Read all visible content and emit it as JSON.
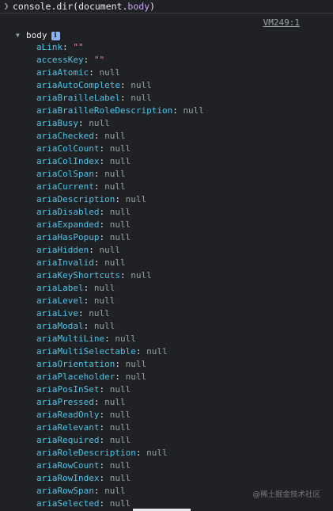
{
  "console": {
    "prompt_icon": "chevron-right-icon",
    "command": {
      "prefix": "console.",
      "method": "dir",
      "open": "(document.",
      "arg_prop": "body",
      "close": ")"
    },
    "source_link": "VM249:1",
    "root": {
      "label": "body",
      "badge": "i",
      "expanded": true
    },
    "properties": [
      {
        "key": "aLink",
        "value": "\"\"",
        "kind": "string"
      },
      {
        "key": "accessKey",
        "value": "\"\"",
        "kind": "string"
      },
      {
        "key": "ariaAtomic",
        "value": "null",
        "kind": "null"
      },
      {
        "key": "ariaAutoComplete",
        "value": "null",
        "kind": "null"
      },
      {
        "key": "ariaBrailleLabel",
        "value": "null",
        "kind": "null"
      },
      {
        "key": "ariaBrailleRoleDescription",
        "value": "null",
        "kind": "null"
      },
      {
        "key": "ariaBusy",
        "value": "null",
        "kind": "null"
      },
      {
        "key": "ariaChecked",
        "value": "null",
        "kind": "null"
      },
      {
        "key": "ariaColCount",
        "value": "null",
        "kind": "null"
      },
      {
        "key": "ariaColIndex",
        "value": "null",
        "kind": "null"
      },
      {
        "key": "ariaColSpan",
        "value": "null",
        "kind": "null"
      },
      {
        "key": "ariaCurrent",
        "value": "null",
        "kind": "null"
      },
      {
        "key": "ariaDescription",
        "value": "null",
        "kind": "null"
      },
      {
        "key": "ariaDisabled",
        "value": "null",
        "kind": "null"
      },
      {
        "key": "ariaExpanded",
        "value": "null",
        "kind": "null"
      },
      {
        "key": "ariaHasPopup",
        "value": "null",
        "kind": "null"
      },
      {
        "key": "ariaHidden",
        "value": "null",
        "kind": "null"
      },
      {
        "key": "ariaInvalid",
        "value": "null",
        "kind": "null"
      },
      {
        "key": "ariaKeyShortcuts",
        "value": "null",
        "kind": "null"
      },
      {
        "key": "ariaLabel",
        "value": "null",
        "kind": "null"
      },
      {
        "key": "ariaLevel",
        "value": "null",
        "kind": "null"
      },
      {
        "key": "ariaLive",
        "value": "null",
        "kind": "null"
      },
      {
        "key": "ariaModal",
        "value": "null",
        "kind": "null"
      },
      {
        "key": "ariaMultiLine",
        "value": "null",
        "kind": "null"
      },
      {
        "key": "ariaMultiSelectable",
        "value": "null",
        "kind": "null"
      },
      {
        "key": "ariaOrientation",
        "value": "null",
        "kind": "null"
      },
      {
        "key": "ariaPlaceholder",
        "value": "null",
        "kind": "null"
      },
      {
        "key": "ariaPosInSet",
        "value": "null",
        "kind": "null"
      },
      {
        "key": "ariaPressed",
        "value": "null",
        "kind": "null"
      },
      {
        "key": "ariaReadOnly",
        "value": "null",
        "kind": "null"
      },
      {
        "key": "ariaRelevant",
        "value": "null",
        "kind": "null"
      },
      {
        "key": "ariaRequired",
        "value": "null",
        "kind": "null"
      },
      {
        "key": "ariaRoleDescription",
        "value": "null",
        "kind": "null"
      },
      {
        "key": "ariaRowCount",
        "value": "null",
        "kind": "null"
      },
      {
        "key": "ariaRowIndex",
        "value": "null",
        "kind": "null"
      },
      {
        "key": "ariaRowSpan",
        "value": "null",
        "kind": "null"
      },
      {
        "key": "ariaSelected",
        "value": "null",
        "kind": "null"
      }
    ]
  },
  "watermark": "@稀土掘金技术社区",
  "colors": {
    "background": "#202124",
    "property_key": "#4fc3e8",
    "null_value": "#9aa0a6",
    "string_value": "#f28b82",
    "text": "#e8eaed"
  }
}
